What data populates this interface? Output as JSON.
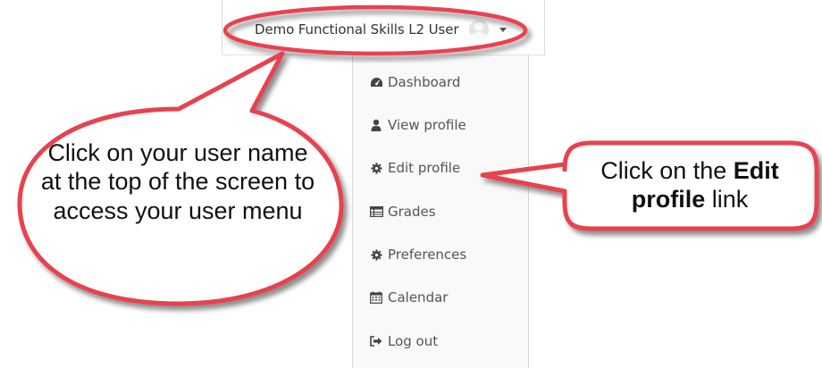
{
  "header": {
    "user_name": "Demo  Functional Skills  L2 User"
  },
  "user_menu": {
    "items": [
      {
        "label": "Dashboard",
        "icon": "dashboard-icon"
      },
      {
        "label": "View profile",
        "icon": "user-icon"
      },
      {
        "label": "Edit profile",
        "icon": "cog-icon"
      },
      {
        "label": "Grades",
        "icon": "grades-table-icon"
      },
      {
        "label": "Preferences",
        "icon": "cog-icon"
      },
      {
        "label": "Calendar",
        "icon": "calendar-icon"
      },
      {
        "label": "Log out",
        "icon": "sign-out-icon"
      }
    ]
  },
  "callouts": {
    "left": {
      "text": "Click on your user name at the top of the screen to access your user menu"
    },
    "right": {
      "prefix": "Click on the ",
      "emphasis": "Edit profile",
      "suffix": " link"
    }
  },
  "colors": {
    "callout_border": "#e8434f",
    "callout_fill": "#ffffff",
    "menu_text": "#555555",
    "menu_background": "#f9f9f9"
  }
}
